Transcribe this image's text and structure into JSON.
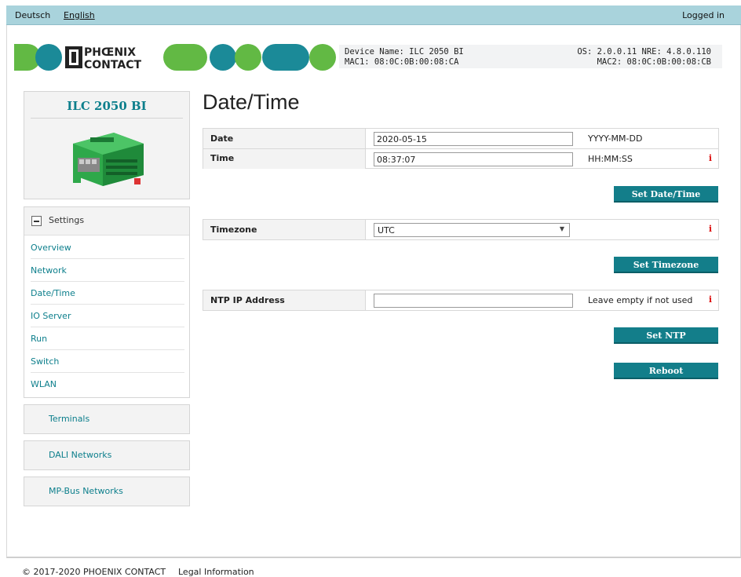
{
  "topbar": {
    "languages": [
      "Deutsch",
      "English"
    ],
    "status": "Logged in"
  },
  "header": {
    "logo_text_line1": "PHŒNIX",
    "logo_text_line2": "CONTACT",
    "device_name": "Device Name: ILC 2050 BI",
    "mac1": "MAC1: 08:0C:0B:00:08:CA",
    "os": "OS: 2.0.0.11 NRE: 4.8.0.110",
    "mac2": "MAC2: 08:0C:0B:00:08:CB"
  },
  "sidebar": {
    "device_title": "ILC 2050 BI",
    "settings_label": "Settings",
    "settings_items": [
      "Overview",
      "Network",
      "Date/Time",
      "IO Server",
      "Run",
      "Switch",
      "WLAN"
    ],
    "sections": [
      "Terminals",
      "DALI Networks",
      "MP-Bus Networks"
    ]
  },
  "main": {
    "title": "Date/Time",
    "date": {
      "label": "Date",
      "value": "2020-05-15",
      "hint": "YYYY-MM-DD"
    },
    "time": {
      "label": "Time",
      "value": "08:37:07",
      "hint": "HH:MM:SS"
    },
    "set_datetime_label": "Set Date/Time",
    "timezone": {
      "label": "Timezone",
      "value": "UTC"
    },
    "set_timezone_label": "Set Timezone",
    "ntp": {
      "label": "NTP IP Address",
      "value": "",
      "hint": "Leave empty if not used"
    },
    "set_ntp_label": "Set NTP",
    "reboot_label": "Reboot",
    "info_glyph": "i"
  },
  "footer": {
    "copyright": "© 2017-2020 PHOENIX CONTACT",
    "legal": "Legal Information"
  },
  "colors": {
    "accent": "#137e8a",
    "topbar": "#a9d3dc",
    "logo_green": "#62b944",
    "logo_teal": "#1b8a98"
  }
}
